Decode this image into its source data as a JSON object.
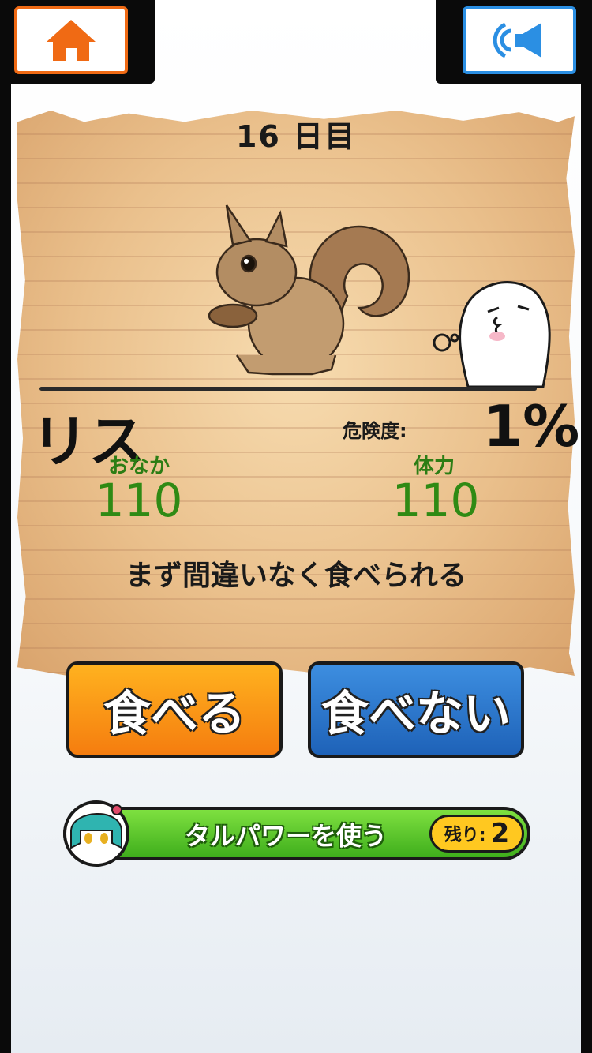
{
  "header": {
    "home_icon": "home-icon",
    "sound_icon": "speaker-icon",
    "accent_home": "#f06a14",
    "accent_sound": "#2b8fe3"
  },
  "card": {
    "day_label": "16 日目",
    "animal_name": "リス",
    "danger_label": "危険度:",
    "danger_value": "1%",
    "hunger_label": "おなか",
    "hunger_value": "110",
    "stamina_label": "体力",
    "stamina_value": "110",
    "description": "まず間違いなく食べられる"
  },
  "actions": {
    "eat_label": "食べる",
    "not_eat_label": "食べない",
    "eat_color": "#f7931a",
    "not_eat_color": "#2d78cf"
  },
  "power": {
    "label": "タルパワーを使う",
    "remaining_label": "残り:",
    "remaining_value": "2"
  }
}
